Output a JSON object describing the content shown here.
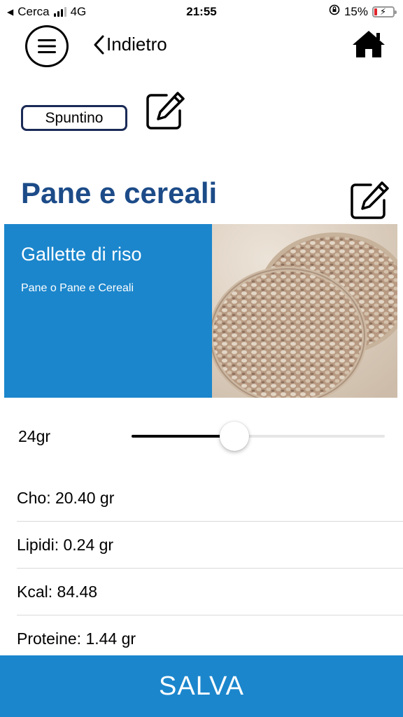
{
  "status_bar": {
    "back_app": "Cerca",
    "network": "4G",
    "time": "21:55",
    "battery": "15%",
    "battery_level": 0.15
  },
  "nav": {
    "back_label": "Indietro"
  },
  "meal": {
    "category_label": "Spuntino"
  },
  "page": {
    "title": "Pane e cereali"
  },
  "food": {
    "name": "Gallette di riso",
    "category": "Pane o Pane e Cereali"
  },
  "quantity": {
    "label": "24gr",
    "slider_fraction": 0.405
  },
  "nutrition": {
    "items": [
      {
        "label": "Cho: 20.40 gr"
      },
      {
        "label": "Lipidi: 0.24 gr"
      },
      {
        "label": "Kcal: 84.48"
      },
      {
        "label": "Proteine: 1.44 gr"
      }
    ]
  },
  "actions": {
    "save_label": "SALVA"
  },
  "colors": {
    "primary_blue": "#1b86cc",
    "title_blue": "#1c4b88",
    "badge_border": "#1a2a56",
    "battery_low": "#e0242c"
  }
}
